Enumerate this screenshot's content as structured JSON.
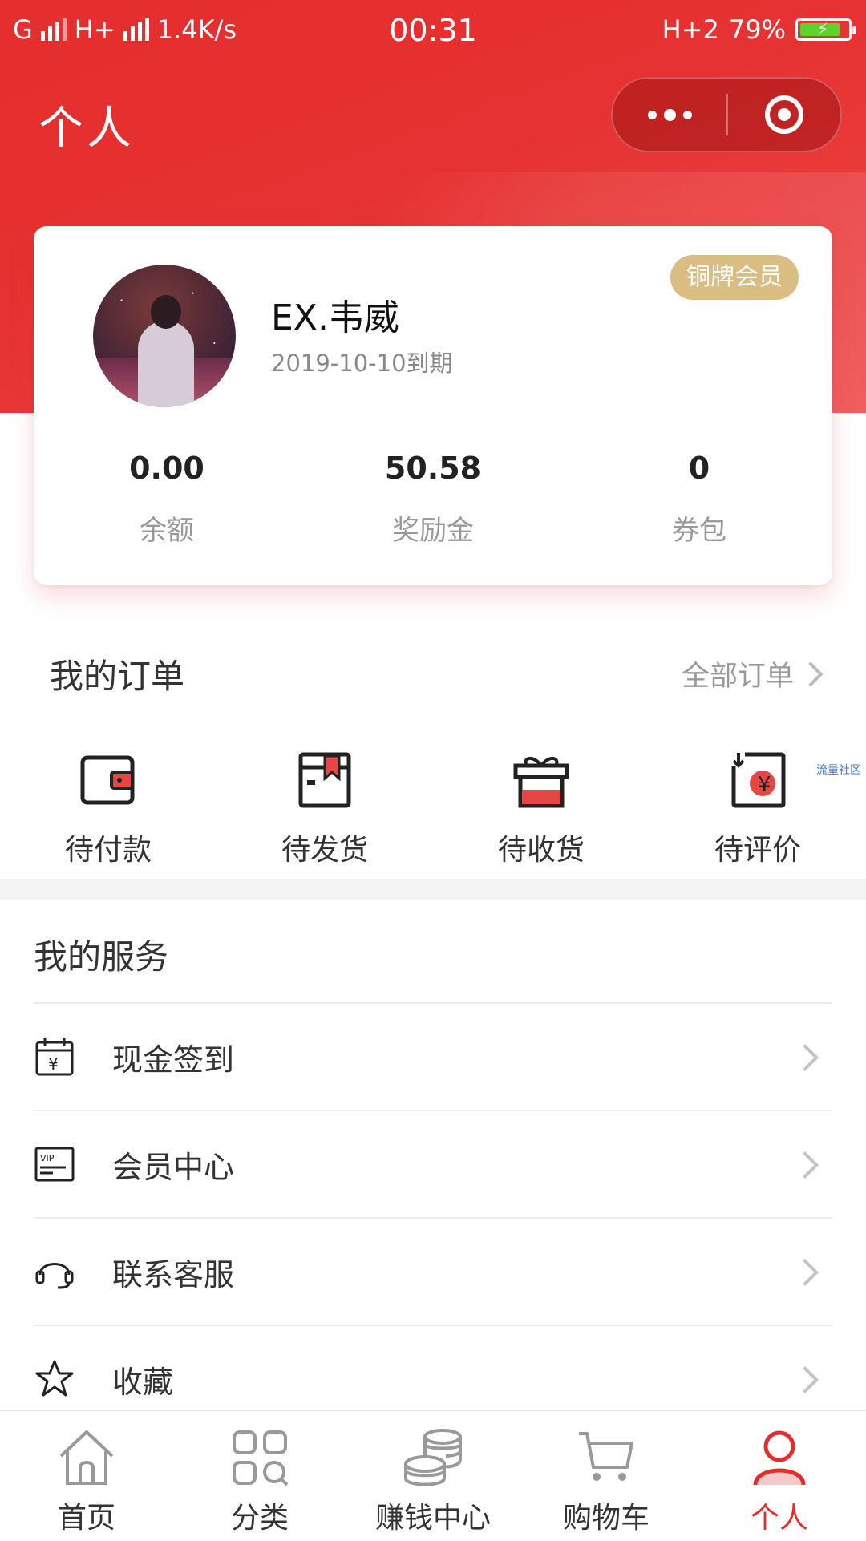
{
  "status_bar": {
    "network1": "G",
    "network2": "H+",
    "speed": "1.4K/s",
    "time": "00:31",
    "network3": "H+2",
    "battery": "79%"
  },
  "nav": {
    "title": "个人"
  },
  "profile": {
    "username": "EX.韦威",
    "expire": "2019-10-10到期",
    "member_level": "铜牌会员",
    "stats": [
      {
        "value": "0.00",
        "label": "余额"
      },
      {
        "value": "50.58",
        "label": "奖励金"
      },
      {
        "value": "0",
        "label": "券包"
      }
    ]
  },
  "orders": {
    "title": "我的订单",
    "all_label": "全部订单",
    "items": [
      {
        "label": "待付款",
        "icon": "wallet-icon"
      },
      {
        "label": "待发货",
        "icon": "package-icon"
      },
      {
        "label": "待收货",
        "icon": "gift-box-icon"
      },
      {
        "label": "待评价",
        "icon": "review-yen-icon"
      }
    ],
    "watermark": "流量社区"
  },
  "services": {
    "title": "我的服务",
    "items": [
      {
        "label": "现金签到",
        "icon": "calendar-yen-icon"
      },
      {
        "label": "会员中心",
        "icon": "vip-card-icon"
      },
      {
        "label": "联系客服",
        "icon": "headset-icon"
      },
      {
        "label": "收藏",
        "icon": "star-icon"
      }
    ]
  },
  "tabbar": {
    "items": [
      {
        "label": "首页",
        "icon": "home-icon"
      },
      {
        "label": "分类",
        "icon": "category-icon"
      },
      {
        "label": "赚钱中心",
        "icon": "coins-icon"
      },
      {
        "label": "购物车",
        "icon": "cart-icon"
      },
      {
        "label": "个人",
        "icon": "person-icon",
        "active": true
      }
    ]
  },
  "colors": {
    "brand_red": "#e52d2d",
    "badge_gold": "#d9bd83"
  }
}
